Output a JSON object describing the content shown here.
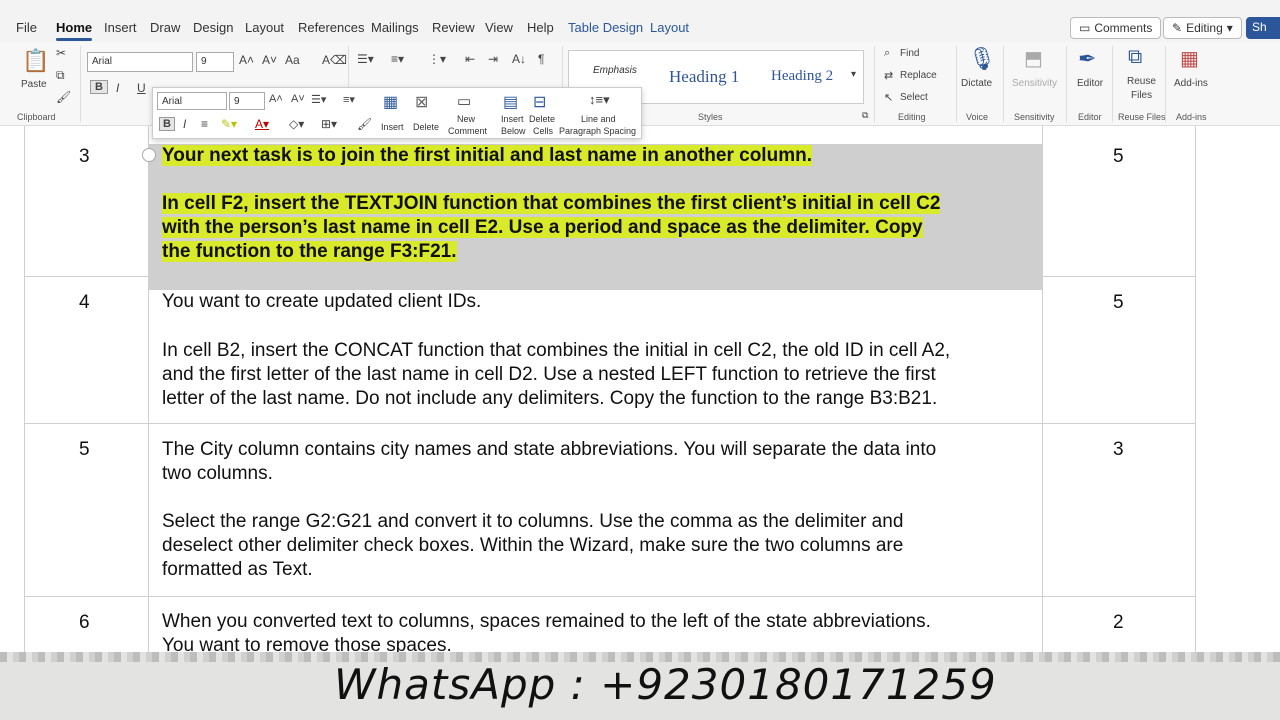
{
  "menu": {
    "tabs": [
      "File",
      "Home",
      "Insert",
      "Draw",
      "Design",
      "Layout",
      "References",
      "Mailings",
      "Review",
      "View",
      "Help"
    ],
    "contextual_tabs": [
      "Table Design",
      "Layout"
    ],
    "comments_label": "Comments",
    "editing_label": "Editing",
    "share_label": "Sh"
  },
  "ribbon": {
    "clipboard": {
      "paste_label": "Paste",
      "group_label": "Clipboard"
    },
    "font": {
      "name": "Arial",
      "size": "9",
      "bold": "B",
      "italic": "I",
      "underline": "U"
    },
    "styles": {
      "items": [
        "Emphasis",
        "Heading 1",
        "Heading 2"
      ],
      "group_label": "Styles"
    },
    "editing": {
      "find": "Find",
      "replace": "Replace",
      "select": "Select",
      "group_label": "Editing"
    },
    "voice": {
      "dictate": "Dictate",
      "group_label": "Voice"
    },
    "sensitivity": {
      "label": "Sensitivity",
      "group_label": "Sensitivity"
    },
    "editor": {
      "label": "Editor",
      "group_label": "Editor"
    },
    "reuse": {
      "label_line1": "Reuse",
      "label_line2": "Files",
      "group_label": "Reuse Files"
    },
    "addins": {
      "label": "Add-ins",
      "group_label": "Add-ins"
    }
  },
  "mini_toolbar": {
    "font": "Arial",
    "size": "9",
    "insert": "Insert",
    "delete": "Delete",
    "new_comment_1": "New",
    "new_comment_2": "Comment",
    "insert_below_1": "Insert",
    "insert_below_2": "Below",
    "delete_cells_1": "Delete",
    "delete_cells_2": "Cells",
    "line_spacing_1": "Line and",
    "line_spacing_2": "Paragraph Spacing"
  },
  "table": {
    "rows": [
      {
        "num": "3",
        "points": "5",
        "lines_a": [
          "Your next task is to join the first initial and last name in another column."
        ],
        "lines_b": [
          "In cell F2, insert the TEXTJOIN function that combines the first client’s initial in cell C2",
          "with the person’s last name in cell E2. Use a period and space as the delimiter. Copy",
          "the function to the range F3:F21."
        ]
      },
      {
        "num": "4",
        "points": "5",
        "lines_a": [
          "You want to create updated client IDs."
        ],
        "lines_b": [
          "In cell B2, insert the CONCAT function that combines the initial in cell C2, the old ID in cell A2,",
          "and the first letter of the last name in cell D2. Use a nested LEFT function to retrieve the first",
          "letter of the last name. Do not include any delimiters. Copy the function to the range B3:B21."
        ]
      },
      {
        "num": "5",
        "points": "3",
        "lines_a": [
          "The City column contains city names and state abbreviations. You will separate the data into",
          "two columns."
        ],
        "lines_b": [
          "Select the range G2:G21 and convert it to columns. Use the comma as the delimiter and",
          "deselect other delimiter check boxes. Within the Wizard, make sure the two columns are",
          "formatted as Text."
        ]
      },
      {
        "num": "6",
        "points": "2",
        "lines_a": [
          "When you converted text to columns, spaces remained to the left of the state abbreviations.",
          "You want to remove those spaces."
        ]
      }
    ]
  },
  "watermark": {
    "text": "WhatsApp : +923018017125​9"
  }
}
